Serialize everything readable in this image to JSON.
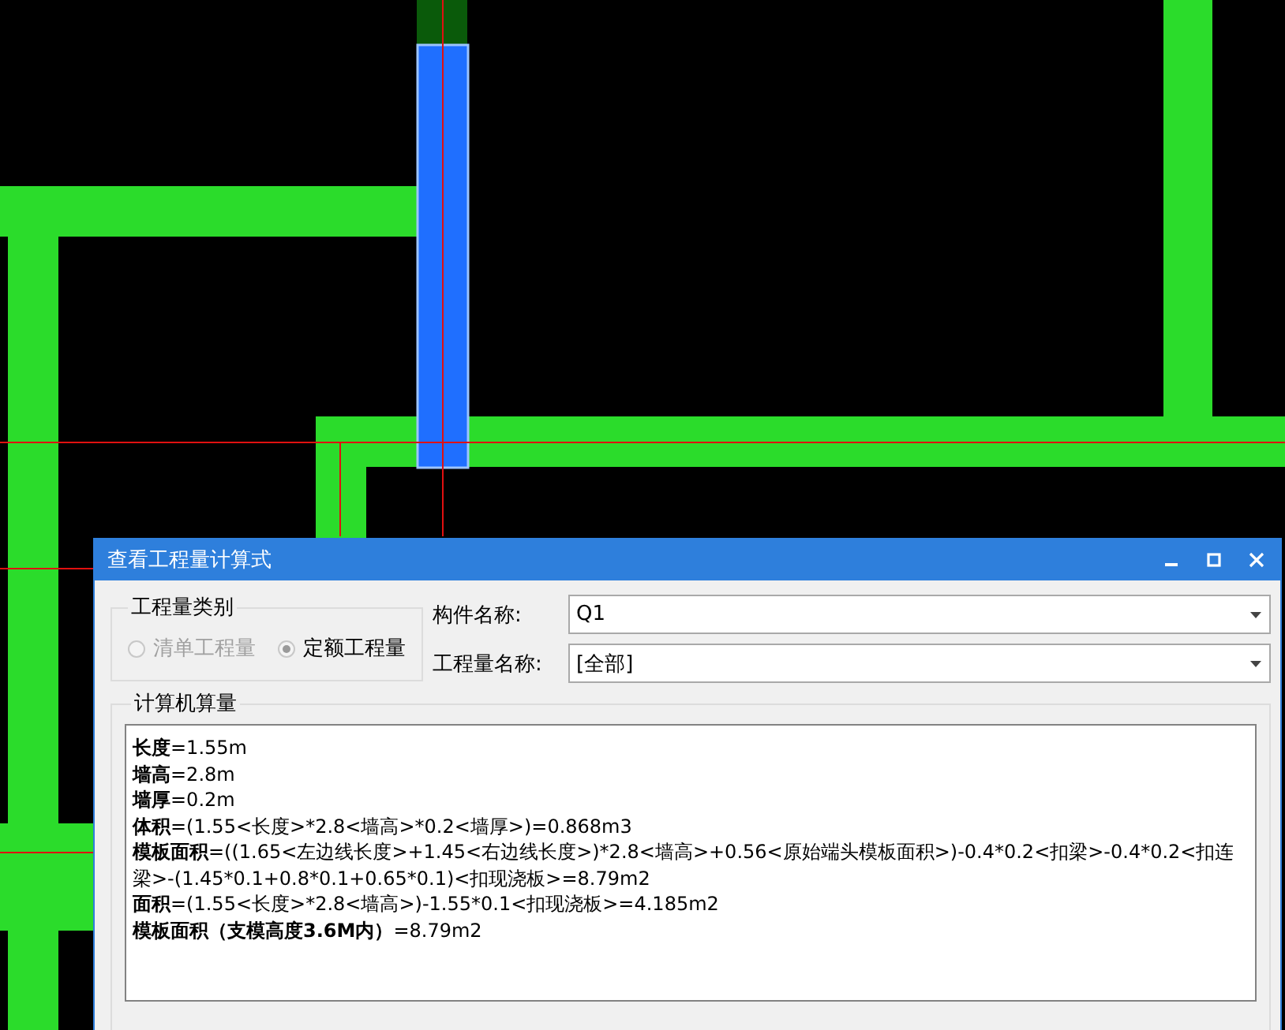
{
  "window": {
    "title": "查看工程量计算式"
  },
  "category": {
    "title": "工程量类别",
    "options": [
      {
        "label": "清单工程量",
        "selected": false,
        "disabled": true
      },
      {
        "label": "定额工程量",
        "selected": true,
        "disabled": false
      }
    ]
  },
  "fields": [
    {
      "label": "构件名称:",
      "value": "Q1"
    },
    {
      "label": "工程量名称:",
      "value": "[全部]"
    }
  ],
  "calc": {
    "title": "计算机算量",
    "lines": [
      "**长度**=1.55m",
      "**墙高**=2.8m",
      "**墙厚**=0.2m",
      "**体积**=(1.55<长度>*2.8<墙高>*0.2<墙厚>)=0.868m3",
      "**模板面积**=((1.65<左边线长度>+1.45<右边线长度>)*2.8<墙高>+0.56<原始端头模板面积>)-0.4*0.2<扣梁>-0.4*0.2<扣连梁>-(1.45*0.1+0.8*0.1+0.65*0.1)<扣现浇板>=8.79m2",
      "**面积**=(1.55<长度>*2.8<墙高>)-1.55*0.1<扣现浇板>=4.185m2",
      "**模板面积（支模高度3.6M内）**=8.79m2"
    ]
  }
}
